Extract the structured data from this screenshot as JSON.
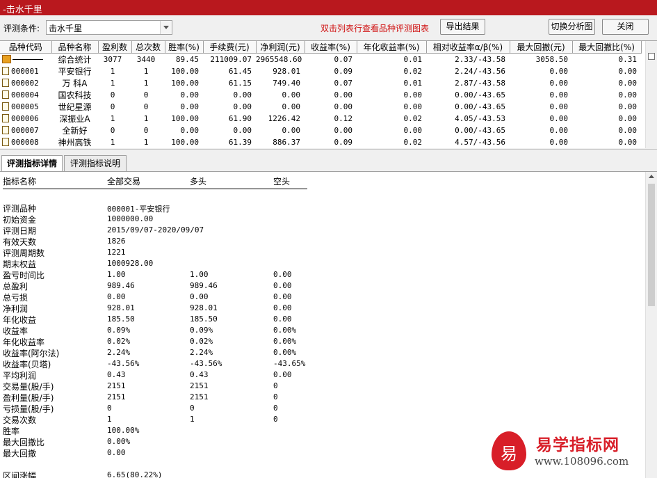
{
  "window": {
    "title": "-击水千里"
  },
  "toolbar": {
    "condition_label": "评测条件:",
    "condition_value": "击水千里",
    "hint": "双击列表行查看品种评测图表",
    "export_label": "导出结果",
    "switch_label": "切换分析图",
    "close_label": "关闭"
  },
  "grid": {
    "columns": [
      "品种代码",
      "品种名称",
      "盈利数",
      "总次数",
      "胜率(%)",
      "手续费(元)",
      "净利润(元)",
      "收益率(%)",
      "年化收益率(%)",
      "相对收益率α/β(%)",
      "最大回撤(元)",
      "最大回撤比(%)"
    ],
    "rows": [
      {
        "code": "",
        "name": "综合统计",
        "wins": "3077",
        "total": "3440",
        "winrate": "89.45",
        "fee": "211009.07",
        "profit": "2965548.60",
        "ret": "0.07",
        "annual": "0.01",
        "rel": "2.33/-43.58",
        "maxdd": "3058.50",
        "ddpct": "0.31"
      },
      {
        "code": "000001",
        "name": "平安银行",
        "wins": "1",
        "total": "1",
        "winrate": "100.00",
        "fee": "61.45",
        "profit": "928.01",
        "ret": "0.09",
        "annual": "0.02",
        "rel": "2.24/-43.56",
        "maxdd": "0.00",
        "ddpct": "0.00"
      },
      {
        "code": "000002",
        "name": "万 科A",
        "wins": "1",
        "total": "1",
        "winrate": "100.00",
        "fee": "61.15",
        "profit": "749.40",
        "ret": "0.07",
        "annual": "0.01",
        "rel": "2.87/-43.58",
        "maxdd": "0.00",
        "ddpct": "0.00"
      },
      {
        "code": "000004",
        "name": "国农科技",
        "wins": "0",
        "total": "0",
        "winrate": "0.00",
        "fee": "0.00",
        "profit": "0.00",
        "ret": "0.00",
        "annual": "0.00",
        "rel": "0.00/-43.65",
        "maxdd": "0.00",
        "ddpct": "0.00"
      },
      {
        "code": "000005",
        "name": "世纪星源",
        "wins": "0",
        "total": "0",
        "winrate": "0.00",
        "fee": "0.00",
        "profit": "0.00",
        "ret": "0.00",
        "annual": "0.00",
        "rel": "0.00/-43.65",
        "maxdd": "0.00",
        "ddpct": "0.00"
      },
      {
        "code": "000006",
        "name": "深振业A",
        "wins": "1",
        "total": "1",
        "winrate": "100.00",
        "fee": "61.90",
        "profit": "1226.42",
        "ret": "0.12",
        "annual": "0.02",
        "rel": "4.05/-43.53",
        "maxdd": "0.00",
        "ddpct": "0.00"
      },
      {
        "code": "000007",
        "name": "全新好",
        "wins": "0",
        "total": "0",
        "winrate": "0.00",
        "fee": "0.00",
        "profit": "0.00",
        "ret": "0.00",
        "annual": "0.00",
        "rel": "0.00/-43.65",
        "maxdd": "0.00",
        "ddpct": "0.00"
      },
      {
        "code": "000008",
        "name": "神州高铁",
        "wins": "1",
        "total": "1",
        "winrate": "100.00",
        "fee": "61.39",
        "profit": "886.37",
        "ret": "0.09",
        "annual": "0.02",
        "rel": "4.57/-43.56",
        "maxdd": "0.00",
        "ddpct": "0.00"
      }
    ]
  },
  "tabs": {
    "detail": "评测指标详情",
    "explain": "评测指标说明"
  },
  "detail": {
    "headers": {
      "name": "指标名称",
      "all": "全部交易",
      "long": "多头",
      "short": "空头"
    },
    "rows": [
      {
        "label": "",
        "all": "",
        "long": "",
        "short": ""
      },
      {
        "label": "评测品种",
        "all": "000001-平安银行",
        "long": "",
        "short": ""
      },
      {
        "label": "初始资金",
        "all": "1000000.00",
        "long": "",
        "short": ""
      },
      {
        "label": "评测日期",
        "all": "2015/09/07-2020/09/07",
        "long": "",
        "short": ""
      },
      {
        "label": "有效天数",
        "all": "1826",
        "long": "",
        "short": ""
      },
      {
        "label": "评测周期数",
        "all": "1221",
        "long": "",
        "short": ""
      },
      {
        "label": "期末权益",
        "all": "1000928.00",
        "long": "",
        "short": ""
      },
      {
        "label": "盈亏时间比",
        "all": "1.00",
        "long": "1.00",
        "short": "0.00"
      },
      {
        "label": "总盈利",
        "all": "989.46",
        "long": "989.46",
        "short": "0.00"
      },
      {
        "label": "总亏损",
        "all": "0.00",
        "long": "0.00",
        "short": "0.00"
      },
      {
        "label": "净利润",
        "all": "928.01",
        "long": "928.01",
        "short": "0.00"
      },
      {
        "label": "年化收益",
        "all": "185.50",
        "long": "185.50",
        "short": "0.00"
      },
      {
        "label": "收益率",
        "all": "0.09%",
        "long": "0.09%",
        "short": "0.00%"
      },
      {
        "label": "年化收益率",
        "all": "0.02%",
        "long": "0.02%",
        "short": "0.00%"
      },
      {
        "label": "收益率(阿尔法)",
        "all": "2.24%",
        "long": "2.24%",
        "short": "0.00%"
      },
      {
        "label": "收益率(贝塔)",
        "all": "-43.56%",
        "long": "-43.56%",
        "short": "-43.65%"
      },
      {
        "label": "平均利润",
        "all": "0.43",
        "long": "0.43",
        "short": "0.00"
      },
      {
        "label": "交易量(股/手)",
        "all": "2151",
        "long": "2151",
        "short": "0"
      },
      {
        "label": "盈利量(股/手)",
        "all": "2151",
        "long": "2151",
        "short": "0"
      },
      {
        "label": "亏损量(股/手)",
        "all": "0",
        "long": "0",
        "short": "0"
      },
      {
        "label": "交易次数",
        "all": "1",
        "long": "1",
        "short": "0"
      },
      {
        "label": "胜率",
        "all": "100.00%",
        "long": "",
        "short": ""
      },
      {
        "label": "最大回撤比",
        "all": "0.00%",
        "long": "",
        "short": ""
      },
      {
        "label": "最大回撤",
        "all": "0.00",
        "long": "",
        "short": ""
      },
      {
        "label": "",
        "all": "",
        "long": "",
        "short": ""
      },
      {
        "label": "区间涨幅",
        "all": "6.65(80.22%)",
        "long": "",
        "short": ""
      }
    ]
  },
  "watermark": {
    "icon_char": "易",
    "brand": "易学指标网",
    "url": "www.108096.com"
  },
  "colors": {
    "title_bar": "#b9181e",
    "hint_text": "#d01010",
    "brand_red": "#d81e28"
  }
}
